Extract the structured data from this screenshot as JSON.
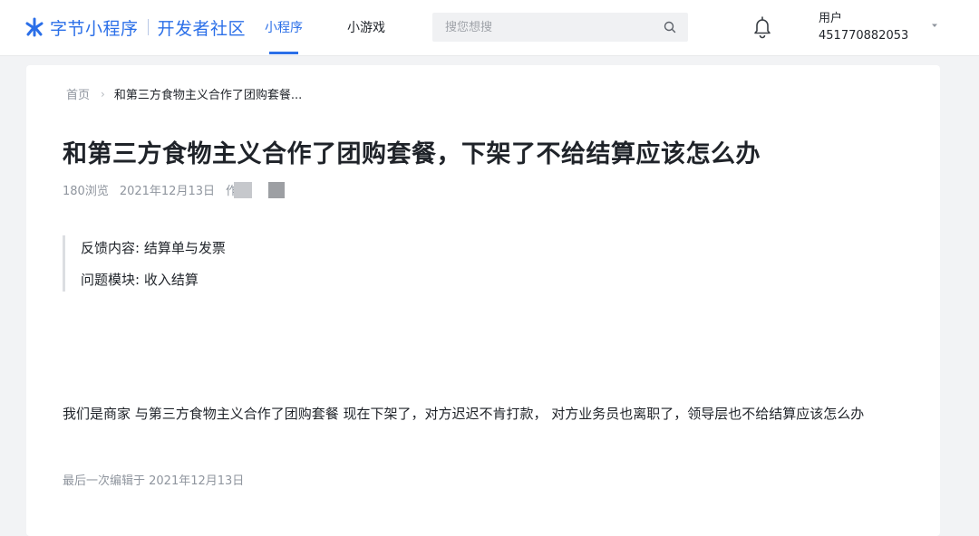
{
  "header": {
    "brand": "字节小程序",
    "subtitle": "开发者社区",
    "tabs": [
      {
        "label": "小程序",
        "active": true
      },
      {
        "label": "小游戏",
        "active": false
      }
    ],
    "search": {
      "placeholder": "搜您想搜"
    },
    "user": {
      "label": "用户",
      "id": "451770882053"
    }
  },
  "breadcrumb": {
    "home": "首页",
    "separator": "›",
    "current": "和第三方食物主义合作了团购套餐..."
  },
  "post": {
    "title": "和第三方食物主义合作了团购套餐，下架了不给结算应该怎么办",
    "views": "180浏览",
    "date": "2021年12月13日",
    "author_prefix": "作",
    "feedback_content": "反馈内容: 结算单与发票",
    "problem_module": "问题模块: 收入结算",
    "body": "我们是商家 与第三方食物主义合作了团购套餐 现在下架了，对方迟迟不肯打款， 对方业务员也离职了，领导层也不给结算应该怎么办",
    "last_edited": "最后一次编辑于 2021年12月13日"
  },
  "colors": {
    "accent": "#2b6fe8",
    "page_bg": "#f2f3f5",
    "muted_text": "#8f959e"
  },
  "icons": [
    "bytedance-logo-icon",
    "search-icon",
    "bell-icon",
    "chevron-down-icon"
  ]
}
